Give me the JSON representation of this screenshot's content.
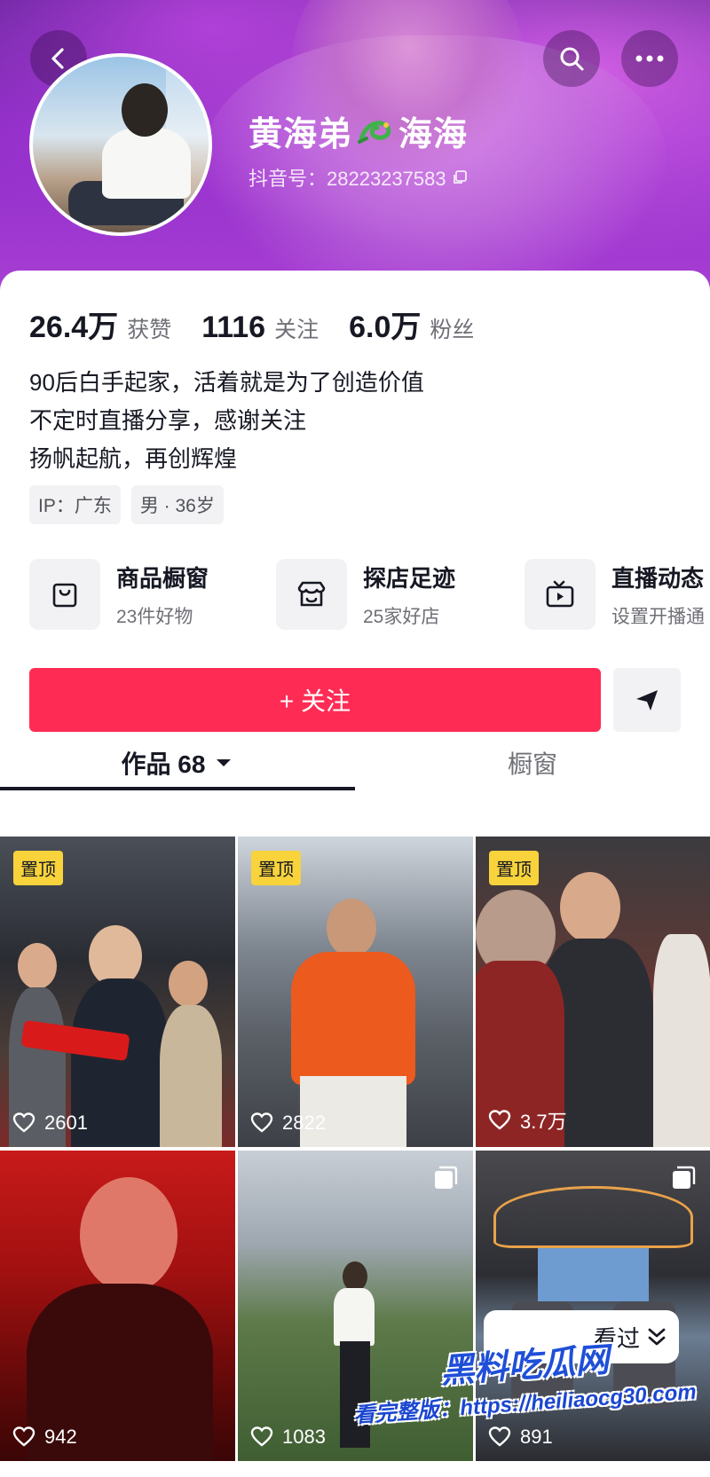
{
  "profile": {
    "name_part1": "黄海弟",
    "name_part2": "海海",
    "douyin_id": "抖音号：28223237583"
  },
  "stats": [
    {
      "value": "26.4万",
      "label": "获赞"
    },
    {
      "value": "1116",
      "label": "关注"
    },
    {
      "value": "6.0万",
      "label": "粉丝"
    }
  ],
  "bio": {
    "line1": "90后白手起家，活着就是为了创造价值",
    "line2": "不定时直播分享，感谢关注",
    "line3": "扬帆起航，再创辉煌"
  },
  "tags": [
    "IP：广东",
    "男 · 36岁"
  ],
  "features": [
    {
      "title": "商品橱窗",
      "subtitle": "23件好物",
      "icon": "shopping-bag-icon"
    },
    {
      "title": "探店足迹",
      "subtitle": "25家好店",
      "icon": "store-icon"
    },
    {
      "title": "直播动态",
      "subtitle": "设置开播通",
      "icon": "tv-icon"
    }
  ],
  "actions": {
    "follow_label": "+ 关注",
    "share_icon": "send-icon"
  },
  "tabs": {
    "works_label": "作品 68",
    "window_label": "橱窗"
  },
  "videos": [
    {
      "pinned": "置顶",
      "likes": "2601"
    },
    {
      "pinned": "置顶",
      "likes": "2822"
    },
    {
      "pinned": "置顶",
      "likes": "3.7万"
    },
    {
      "likes": "942"
    },
    {
      "likes": "1083"
    },
    {
      "likes": "891"
    }
  ],
  "overlay": {
    "seen_label": "看过",
    "watermark_logo": "黑料吃瓜网",
    "watermark_url": "看完整版：https://heiliaocg30.com"
  },
  "colors": {
    "follow": "#fe2c55",
    "pin_badge": "#f8d33b",
    "cover": "#8c2bc8"
  }
}
